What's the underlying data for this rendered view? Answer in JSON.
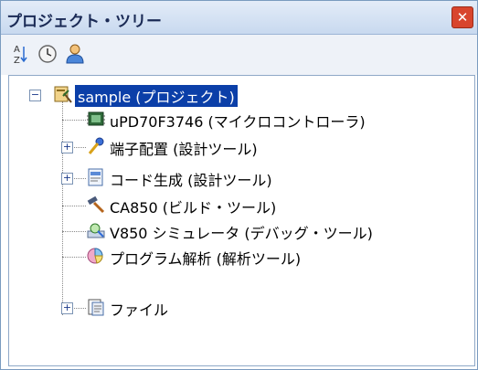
{
  "panel": {
    "title": "プロジェクト・ツリー"
  },
  "toolbar": {
    "buttons": [
      {
        "icon": "sort-az-icon"
      },
      {
        "icon": "clock-icon"
      },
      {
        "icon": "user-icon"
      }
    ]
  },
  "tree": {
    "root": {
      "label": "sample (プロジェクト)",
      "expanded": true,
      "selected": true,
      "icon": "project-icon"
    },
    "children": [
      {
        "label": "uPD70F3746 (マイクロコントローラ)",
        "icon": "microcontroller-icon",
        "expandable": false
      },
      {
        "label": "端子配置 (設計ツール)",
        "icon": "pin-config-icon",
        "expandable": true
      },
      {
        "label": "コード生成 (設計ツール)",
        "icon": "code-gen-icon",
        "expandable": true
      },
      {
        "label": "CA850 (ビルド・ツール)",
        "icon": "build-hammer-icon",
        "expandable": false
      },
      {
        "label": "V850 シミュレータ (デバッグ・ツール)",
        "icon": "simulator-icon",
        "expandable": false
      },
      {
        "label": "プログラム解析 (解析ツール)",
        "icon": "analysis-icon",
        "expandable": false
      },
      {
        "label": "ファイル",
        "icon": "folder-icon",
        "expandable": true
      }
    ]
  },
  "colors": {
    "selection": "#0b3fa8",
    "titlebar": "#c8d9ef",
    "close": "#d8452d"
  }
}
